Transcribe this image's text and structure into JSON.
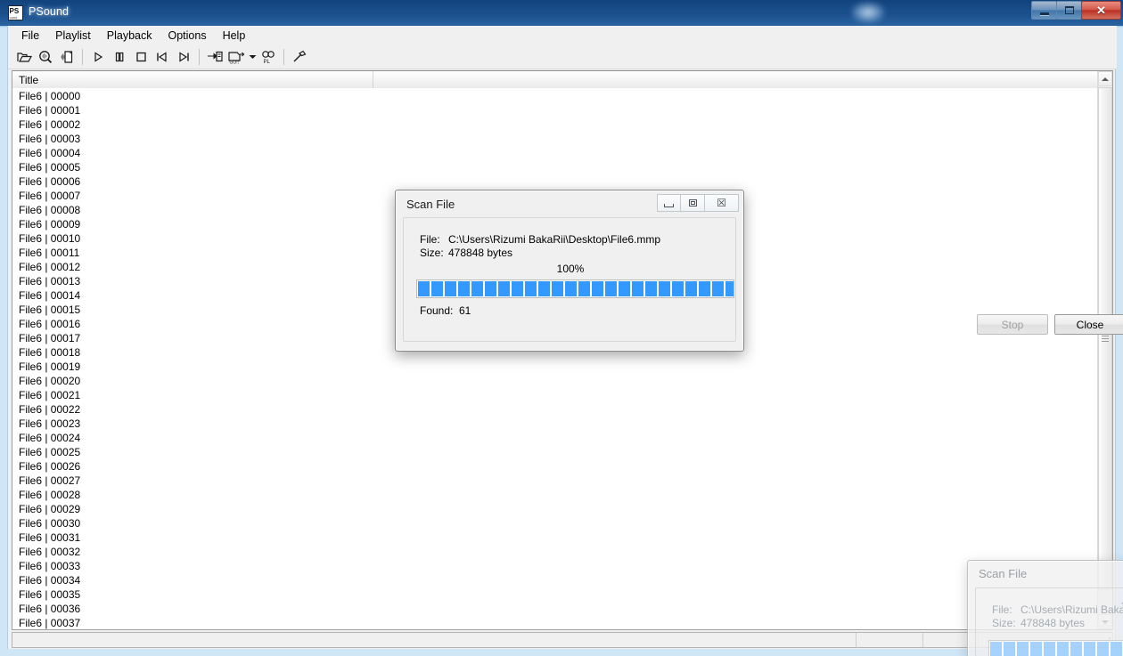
{
  "window": {
    "title": "PSound",
    "icon": "psound-app-icon",
    "caption_buttons": [
      {
        "name": "minimize",
        "glyph": "minimize-icon"
      },
      {
        "name": "maximize",
        "glyph": "maximize-icon"
      },
      {
        "name": "close",
        "glyph": "close-icon",
        "label": "✕"
      }
    ]
  },
  "menu": {
    "items": [
      {
        "label": "File"
      },
      {
        "label": "Playlist"
      },
      {
        "label": "Playback"
      },
      {
        "label": "Options"
      },
      {
        "label": "Help"
      }
    ]
  },
  "toolbar": {
    "buttons": [
      {
        "name": "open-file-icon",
        "title": "Open"
      },
      {
        "name": "scan-file-icon",
        "title": "Scan File"
      },
      {
        "name": "scan-folder-icon",
        "title": "Scan Folder"
      },
      {
        "name": "play-icon",
        "title": "Play"
      },
      {
        "name": "pause-icon",
        "title": "Pause"
      },
      {
        "name": "stop-icon",
        "title": "Stop"
      },
      {
        "name": "previous-track-icon",
        "title": "Previous"
      },
      {
        "name": "next-track-icon",
        "title": "Next"
      },
      {
        "name": "export-icon",
        "title": "Export"
      },
      {
        "name": "export-playlist-icon",
        "title": "Export Playlist"
      },
      {
        "name": "playlist-settings-icon",
        "title": "Playlist"
      },
      {
        "name": "tools-icon",
        "title": "Tools"
      }
    ]
  },
  "list": {
    "columns": [
      "Title",
      ""
    ],
    "rows": [
      "File6 | 00000",
      "File6 | 00001",
      "File6 | 00002",
      "File6 | 00003",
      "File6 | 00004",
      "File6 | 00005",
      "File6 | 00006",
      "File6 | 00007",
      "File6 | 00008",
      "File6 | 00009",
      "File6 | 00010",
      "File6 | 00011",
      "File6 | 00012",
      "File6 | 00013",
      "File6 | 00014",
      "File6 | 00015",
      "File6 | 00016",
      "File6 | 00017",
      "File6 | 00018",
      "File6 | 00019",
      "File6 | 00020",
      "File6 | 00021",
      "File6 | 00022",
      "File6 | 00023",
      "File6 | 00024",
      "File6 | 00025",
      "File6 | 00026",
      "File6 | 00027",
      "File6 | 00028",
      "File6 | 00029",
      "File6 | 00030",
      "File6 | 00031",
      "File6 | 00032",
      "File6 | 00033",
      "File6 | 00034",
      "File6 | 00035",
      "File6 | 00036",
      "File6 | 00037"
    ]
  },
  "status_bar": {
    "cells": [
      "",
      "",
      "",
      ""
    ]
  },
  "scan_dialog": {
    "title": "Scan File",
    "file_label": "File:",
    "file_value": "C:\\Users\\Rizumi BakaRii\\Desktop\\File6.mmp",
    "size_label": "Size:",
    "size_value": "478848 bytes",
    "percent": "100%",
    "progress_value": 100,
    "progress_blocks": 27,
    "found_label": "Found:",
    "found_value": "61",
    "stop_button": "Stop",
    "stop_enabled": false,
    "close_button": "Close",
    "close_enabled": true,
    "caption_buttons": [
      {
        "name": "minimize",
        "glyph": "minimize-icon"
      },
      {
        "name": "maximize",
        "glyph": "maximize-icon"
      },
      {
        "name": "close",
        "glyph": "close-icon",
        "label": "☒"
      }
    ],
    "accent_color": "#3399ff"
  },
  "ghost_dialog": {
    "title": "Scan File",
    "file_label": "File:",
    "file_value": "C:\\Users\\Rizumi BakaRii\\D",
    "size_label": "Size:",
    "size_value": "478848 bytes",
    "progress_blocks": 13
  },
  "colors": {
    "titlebar_blue": "#1a4f8c",
    "frame_blue": "#8fc2e8",
    "progress_blue": "#3399ff",
    "close_red": "#b93124",
    "client_gray": "#f0f0f0"
  }
}
